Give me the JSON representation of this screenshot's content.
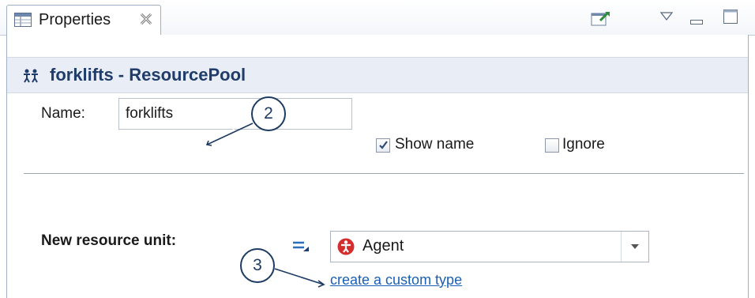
{
  "tab": {
    "label": "Properties"
  },
  "header": {
    "title": "forklifts - ResourcePool"
  },
  "form": {
    "name_label": "Name:",
    "name_value": "forklifts",
    "show_name_label": "Show name",
    "show_name_checked": true,
    "ignore_label": "Ignore",
    "ignore_checked": false,
    "new_resource_unit_label": "New resource unit:",
    "resource_unit_value": "Agent",
    "create_custom_type_link": "create a custom type"
  },
  "callouts": {
    "c2": "2",
    "c3": "3"
  },
  "icons": {
    "tab": "properties-icon",
    "close": "close-icon",
    "pin": "pin-icon",
    "menu": "view-menu-icon",
    "minimize": "minimize-icon",
    "maximize": "maximize-icon",
    "header": "resource-pool-icon",
    "static_toggle": "static-value-icon",
    "agent": "agent-icon",
    "dropdown": "chevron-down-icon"
  },
  "colors": {
    "header_bg": "#e9eef6",
    "header_text": "#1f3c6a",
    "link": "#1a5fb4",
    "callout": "#1d3a63",
    "agent_red": "#d32f2f"
  }
}
